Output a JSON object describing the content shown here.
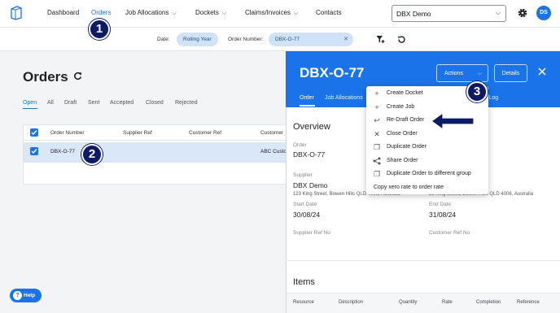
{
  "nav": {
    "items": [
      {
        "label": "Dashboard",
        "dropdown": false
      },
      {
        "label": "Orders",
        "dropdown": false,
        "active": true
      },
      {
        "label": "Job Allocations",
        "dropdown": true
      },
      {
        "label": "Dockets",
        "dropdown": true
      },
      {
        "label": "Claims/Invoices",
        "dropdown": true
      },
      {
        "label": "Contacts",
        "dropdown": false
      }
    ],
    "org_select": "DBX Demo",
    "avatar_initials": "DS"
  },
  "filters": {
    "date_label": "Date:",
    "date_value": "Rolling Year",
    "order_number_label": "Order Number:",
    "order_number_value": "DBX-O-77"
  },
  "orders": {
    "title": "Orders",
    "status_tabs": [
      "Open",
      "All",
      "Draft",
      "Sent",
      "Accepted",
      "Closed",
      "Rejected"
    ],
    "active_tab": "Open",
    "columns": [
      "Order Number",
      "Supplier Ref",
      "Customer Ref",
      "Customer"
    ],
    "rows": [
      {
        "order_number": "DBX-O-77",
        "supplier_ref": "",
        "customer_ref": "",
        "customer": "ABC Custo"
      }
    ]
  },
  "panel": {
    "title": "DBX-O-77",
    "actions_label": "Actions",
    "details_label": "Details",
    "tabs": [
      "Order",
      "Job Allocations",
      "s Log"
    ],
    "overview_title": "Overview",
    "order_label": "Order",
    "order_value": "DBX-O-77",
    "supplier_label": "Supplier",
    "supplier_name": "DBX Demo",
    "supplier_address": "123 King Street, Bowen Hills QLD 4006, Australia",
    "customer_address": "23 King Street, Bowen Hills QLD 4006, Australia",
    "start_date_label": "Start Date",
    "start_date": "30/08/24",
    "end_date_label": "End Date",
    "end_date": "31/08/24",
    "supplier_ref_label": "Supplier Ref No",
    "customer_ref_label": "Customer Ref No",
    "items_title": "Items",
    "item_columns": [
      "Resource",
      "Description",
      "Quantity",
      "Rate",
      "Completion",
      "Reference"
    ]
  },
  "actions_menu": [
    {
      "icon": "plus-icon",
      "label": "Create Docket"
    },
    {
      "icon": "plus-icon",
      "label": "Create Job"
    },
    {
      "icon": "undo-icon",
      "label": "Re-Draft Order"
    },
    {
      "icon": "close-icon",
      "label": "Close Order"
    },
    {
      "icon": "copy-icon",
      "label": "Duplicate Order"
    },
    {
      "icon": "share-icon",
      "label": "Share Order"
    },
    {
      "icon": "copy-icon",
      "label": "Duplicate Order to different group"
    },
    {
      "icon": "",
      "label": "Copy xero rate to order rate"
    }
  ],
  "help_label": "Help",
  "callouts": [
    "1",
    "2",
    "3"
  ],
  "colors": {
    "accent": "#1a73e8",
    "callout": "#0d1a66",
    "chip_bg": "#cfe2f7",
    "selected_row": "#d9e7f7"
  }
}
